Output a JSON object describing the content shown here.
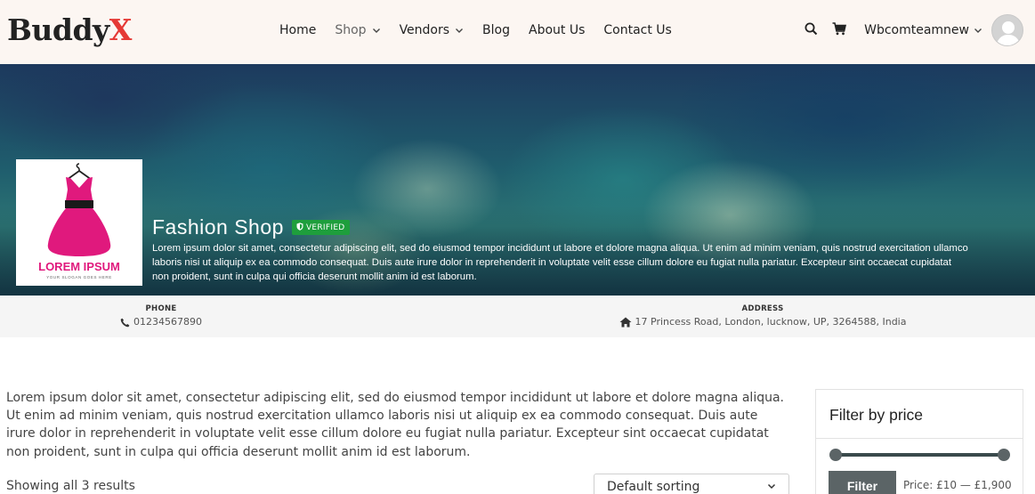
{
  "brand": {
    "logo_main": "Buddy",
    "logo_accent": "X",
    "accent_color": "#e53935"
  },
  "nav": {
    "items": [
      {
        "label": "Home",
        "has_dropdown": false,
        "active": false
      },
      {
        "label": "Shop",
        "has_dropdown": true,
        "active": true
      },
      {
        "label": "Vendors",
        "has_dropdown": true,
        "active": false
      },
      {
        "label": "Blog",
        "has_dropdown": false,
        "active": false
      },
      {
        "label": "About Us",
        "has_dropdown": false,
        "active": false
      },
      {
        "label": "Contact Us",
        "has_dropdown": false,
        "active": false
      }
    ]
  },
  "header_right": {
    "search_icon": "search-icon",
    "cart_icon": "cart-icon",
    "username": "Wbcomteamnew",
    "avatar_icon": "default-avatar-icon"
  },
  "store": {
    "name": "Fashion Shop",
    "verified_label": "VERIFIED",
    "logo": {
      "icon": "dress-on-hanger-icon",
      "text": "LOREM IPSUM",
      "tagline": "YOUR SLOGAN GOES HERE",
      "accent_color": "#e0197d"
    },
    "description_lines": [
      "Lorem ipsum dolor sit amet, consectetur adipiscing elit, sed do eiusmod tempor incididunt ut labore et dolore magna aliqua. Ut enim ad minim veniam, quis nostrud exercitation ullamco",
      "laboris nisi ut aliquip ex ea commodo consequat. Duis aute irure dolor in reprehenderit in voluptate velit esse cillum dolore eu fugiat nulla pariatur. Excepteur sint occaecat cupidatat",
      "non proident, sunt in culpa qui officia deserunt mollit anim id est laborum."
    ],
    "verified_color": "#1e9e3c"
  },
  "info": {
    "phone_label": "PHONE",
    "phone_value": "01234567890",
    "phone_icon": "phone-icon",
    "address_label": "ADDRESS",
    "address_value": "17 Princess Road, London, lucknow, UP, 3264588, India",
    "address_icon": "home-icon"
  },
  "main": {
    "description": "Lorem ipsum dolor sit amet, consectetur adipiscing elit, sed do eiusmod tempor incididunt ut labore et dolore magna aliqua. Ut enim ad minim veniam, quis nostrud exercitation ullamco laboris nisi ut aliquip ex ea commodo consequat. Duis aute irure dolor in reprehenderit in voluptate velit esse cillum dolore eu fugiat nulla pariatur. Excepteur sint occaecat cupidatat non proident, sunt in culpa qui officia deserunt mollit anim id est laborum.",
    "result_count": "Showing all 3 results",
    "sorting_selected": "Default sorting"
  },
  "sidebar": {
    "filter_title": "Filter by price",
    "filter_button": "Filter",
    "price_label": "Price: £10 — £1,900",
    "slider_color": "#5b6466"
  }
}
